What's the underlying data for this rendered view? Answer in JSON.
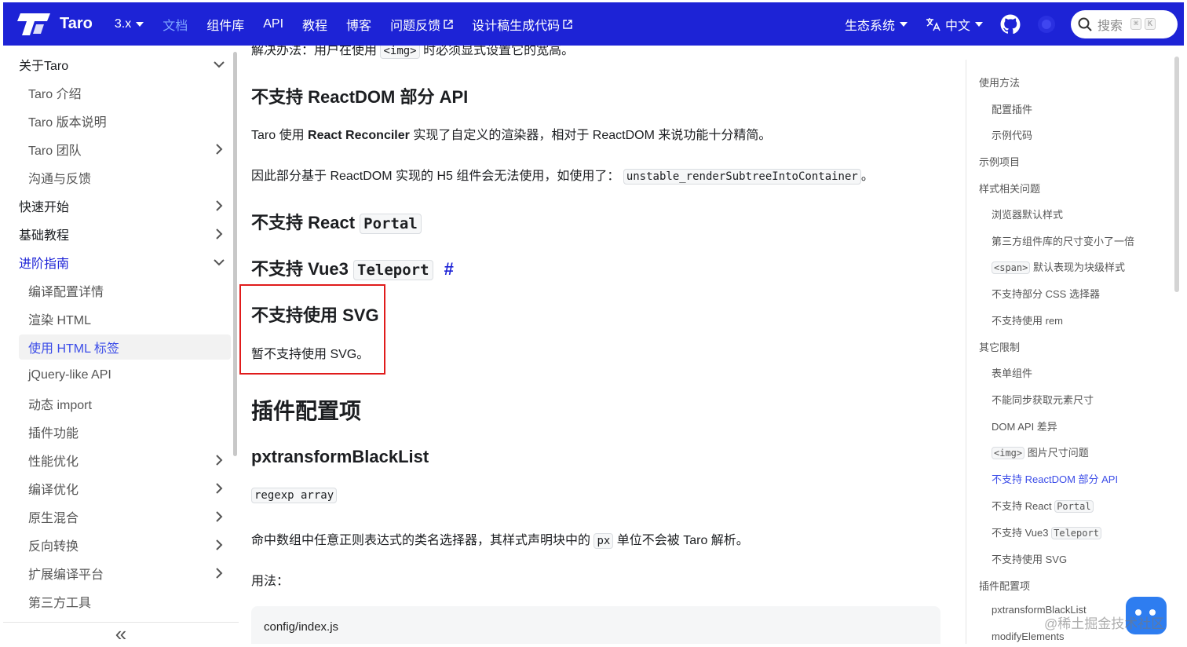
{
  "navbar": {
    "logo_text": "Taro",
    "version": "3.x",
    "items": [
      {
        "label": "文档",
        "active": true,
        "external": false
      },
      {
        "label": "组件库",
        "active": false,
        "external": false
      },
      {
        "label": "API",
        "active": false,
        "external": false
      },
      {
        "label": "教程",
        "active": false,
        "external": false
      },
      {
        "label": "博客",
        "active": false,
        "external": false
      },
      {
        "label": "问题反馈",
        "active": false,
        "external": true
      },
      {
        "label": "设计稿生成代码",
        "active": false,
        "external": true
      }
    ],
    "ecosystem": "生态系统",
    "language": "中文",
    "search_placeholder": "搜索",
    "shortcut_cmd": "⌘",
    "shortcut_key": "K",
    "brand_color": "#1d23d6"
  },
  "sidebar": {
    "items": [
      {
        "label": "关于Taro",
        "level": 1,
        "chevron": "down"
      },
      {
        "label": "Taro 介绍",
        "level": 2
      },
      {
        "label": "Taro 版本说明",
        "level": 2
      },
      {
        "label": "Taro 团队",
        "level": 2,
        "chevron": "right"
      },
      {
        "label": "沟通与反馈",
        "level": 2
      },
      {
        "label": "快速开始",
        "level": 1,
        "chevron": "right"
      },
      {
        "label": "基础教程",
        "level": 1,
        "chevron": "right"
      },
      {
        "label": "进阶指南",
        "level": 1,
        "chevron": "down",
        "highlight": true
      },
      {
        "label": "编译配置详情",
        "level": 2
      },
      {
        "label": "渲染 HTML",
        "level": 2
      },
      {
        "label": "使用 HTML 标签",
        "level": 2,
        "active": true
      },
      {
        "label": "jQuery-like API",
        "level": 2
      },
      {
        "label": "动态 import",
        "level": 2
      },
      {
        "label": "插件功能",
        "level": 2
      },
      {
        "label": "性能优化",
        "level": 2,
        "chevron": "right"
      },
      {
        "label": "编译优化",
        "level": 2,
        "chevron": "right"
      },
      {
        "label": "原生混合",
        "level": 2,
        "chevron": "right"
      },
      {
        "label": "反向转换",
        "level": 2,
        "chevron": "right"
      },
      {
        "label": "扩展编译平台",
        "level": 2,
        "chevron": "right"
      },
      {
        "label": "第三方工具",
        "level": 2
      }
    ],
    "collapse_label": "«"
  },
  "content": {
    "cut_line_a": "解决办法：用户在使用",
    "cut_line_code": "<img>",
    "cut_line_b": "时必须显式设置它的宽高。",
    "h_reactdom": "不支持 ReactDOM 部分 API",
    "p1_a": "Taro 使用",
    "p1_bold": "React Reconciler",
    "p1_b": "实现了自定义的渲染器，相对于 ReactDOM 来说功能十分精简。",
    "p2_a": "因此部分基于 ReactDOM 实现的 H5 组件会无法使用，如使用了：",
    "p2_code": "unstable_renderSubtreeIntoContainer",
    "p2_b": "。",
    "h_portal": "不支持 React",
    "h_portal_code": "Portal",
    "h_teleport": "不支持 Vue3",
    "h_teleport_code": "Teleport",
    "hash": "#",
    "h_svg": "不支持使用 SVG",
    "p_svg": "暂不支持使用 SVG。",
    "h2_plugin": "插件配置项",
    "h_blacklist": "pxtransformBlackList",
    "type_code": "regexp array",
    "p3_a": "命中数组中任意正则表达式的类名选择器，其样式声明块中的",
    "p3_code": "px",
    "p3_b": "单位不会被 Taro 解析。",
    "usage": "用法：",
    "code_title": "config/index.js"
  },
  "toc": {
    "items": [
      {
        "label": "使用方法",
        "level": 1
      },
      {
        "label": "配置插件",
        "level": 2
      },
      {
        "label": "示例代码",
        "level": 2
      },
      {
        "label": "示例项目",
        "level": 1
      },
      {
        "label": "样式相关问题",
        "level": 1
      },
      {
        "label": "浏览器默认样式",
        "level": 2
      },
      {
        "label": "第三方组件库的尺寸变小了一倍",
        "level": 2
      },
      {
        "label": "默认表现为块级样式",
        "level": 2,
        "code": "<span>"
      },
      {
        "label": "不支持部分 CSS 选择器",
        "level": 2
      },
      {
        "label": "不支持使用 rem",
        "level": 2
      },
      {
        "label": "其它限制",
        "level": 1
      },
      {
        "label": "表单组件",
        "level": 2
      },
      {
        "label": "不能同步获取元素尺寸",
        "level": 2
      },
      {
        "label": "DOM API 差异",
        "level": 2
      },
      {
        "label": "图片尺寸问题",
        "level": 2,
        "code": "<img>"
      },
      {
        "label": "不支持 ReactDOM 部分 API",
        "level": 2,
        "active": true
      },
      {
        "label": "不支持 React",
        "level": 2,
        "code_after": "Portal"
      },
      {
        "label": "不支持 Vue3",
        "level": 2,
        "code_after": "Teleport"
      },
      {
        "label": "不支持使用 SVG",
        "level": 2
      },
      {
        "label": "插件配置项",
        "level": 1
      },
      {
        "label": "pxtransformBlackList",
        "level": 2
      },
      {
        "label": "modifyElements",
        "level": 2
      }
    ]
  },
  "watermark": "@稀土掘金技术社区"
}
